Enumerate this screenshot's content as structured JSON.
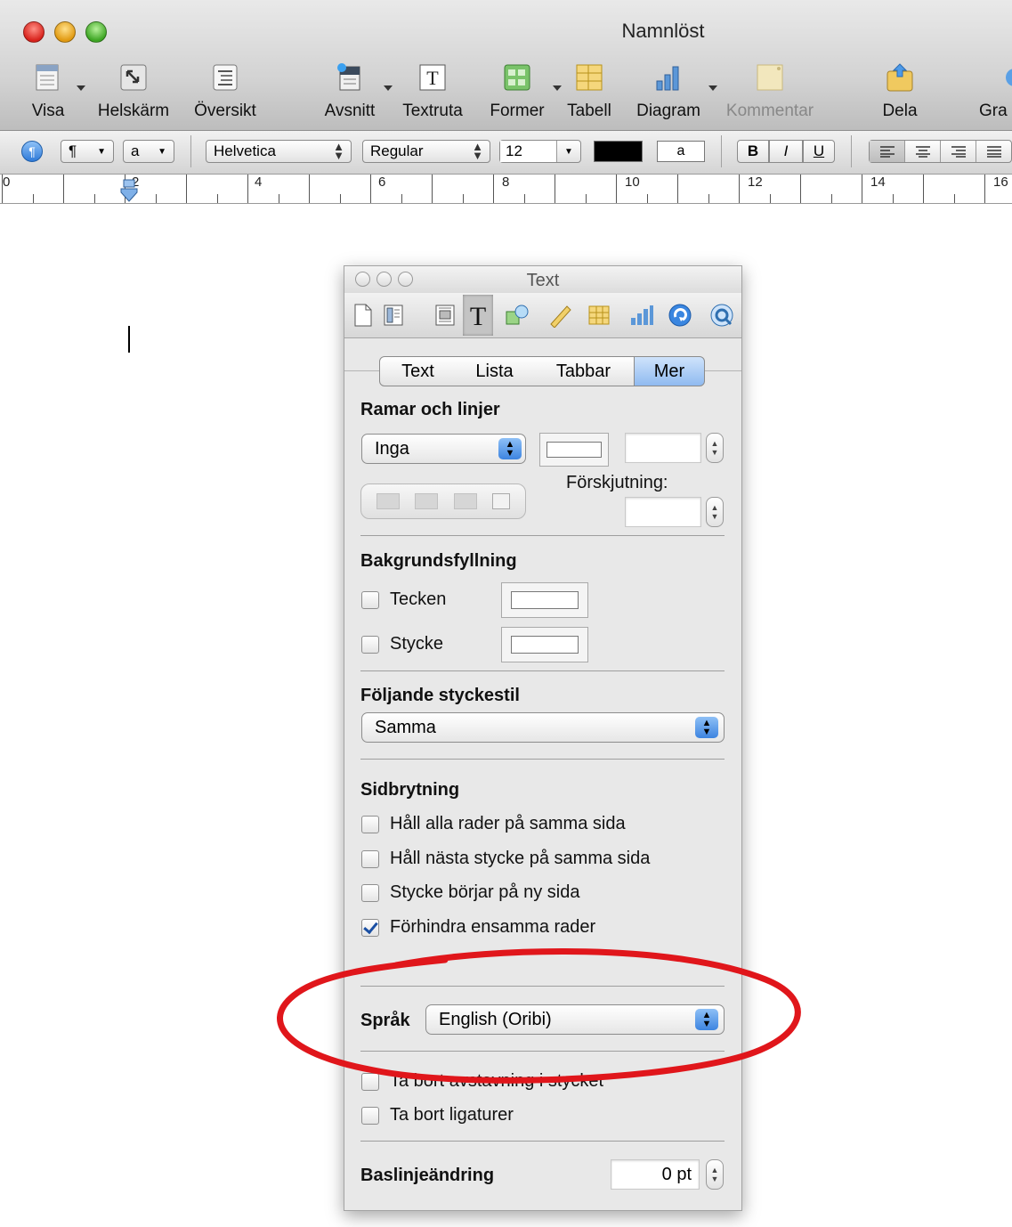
{
  "window": {
    "title": "Namnlöst"
  },
  "toolbar": {
    "items": [
      {
        "label": "Visa",
        "icon": "view-icon"
      },
      {
        "label": "Helskärm",
        "icon": "fullscreen-icon"
      },
      {
        "label": "Översikt",
        "icon": "outline-icon"
      },
      {
        "label": "Avsnitt",
        "icon": "section-icon"
      },
      {
        "label": "Textruta",
        "icon": "textbox-icon"
      },
      {
        "label": "Former",
        "icon": "shapes-icon"
      },
      {
        "label": "Tabell",
        "icon": "table-icon"
      },
      {
        "label": "Diagram",
        "icon": "chart-icon"
      },
      {
        "label": "Kommentar",
        "icon": "comment-icon",
        "disabled": true
      },
      {
        "label": "Dela",
        "icon": "share-icon"
      },
      {
        "label": "Gra",
        "icon": "graphic-icon"
      }
    ]
  },
  "format_bar": {
    "paragraph_style": "¶",
    "char_style": "a",
    "font_family": "Helvetica",
    "font_weight": "Regular",
    "font_size": "12",
    "text_color": "#000000",
    "highlight_label": "a",
    "bold": "B",
    "italic": "I",
    "underline": "U"
  },
  "ruler": {
    "labels": [
      "0",
      "2",
      "4",
      "6",
      "8",
      "10",
      "12",
      "14",
      "16"
    ]
  },
  "inspector": {
    "title": "Text",
    "tabs": [
      "Text",
      "Lista",
      "Tabbar",
      "Mer"
    ],
    "selected_tab": "Mer",
    "borders": {
      "title": "Ramar och linjer",
      "style_value": "Inga",
      "offset_label": "Förskjutning:"
    },
    "background_fill": {
      "title": "Bakgrundsfyllning",
      "character_label": "Tecken",
      "paragraph_label": "Stycke"
    },
    "following_style": {
      "title": "Följande styckestil",
      "value": "Samma"
    },
    "pagination": {
      "title": "Sidbrytning",
      "options": [
        {
          "label": "Håll alla rader på samma sida",
          "checked": false
        },
        {
          "label": "Håll nästa stycke på samma sida",
          "checked": false
        },
        {
          "label": "Stycke börjar på ny sida",
          "checked": false
        },
        {
          "label": "Förhindra ensamma rader",
          "checked": true
        }
      ]
    },
    "language": {
      "label": "Språk",
      "value": "English (Oribi)"
    },
    "extra_options": [
      {
        "label": "Ta bort avstavning i stycket",
        "checked": false
      },
      {
        "label": "Ta bort ligaturer",
        "checked": false
      }
    ],
    "baseline_shift": {
      "label": "Baslinjeändring",
      "value": "0 pt"
    }
  },
  "annotation": {
    "color": "#e0161b"
  }
}
